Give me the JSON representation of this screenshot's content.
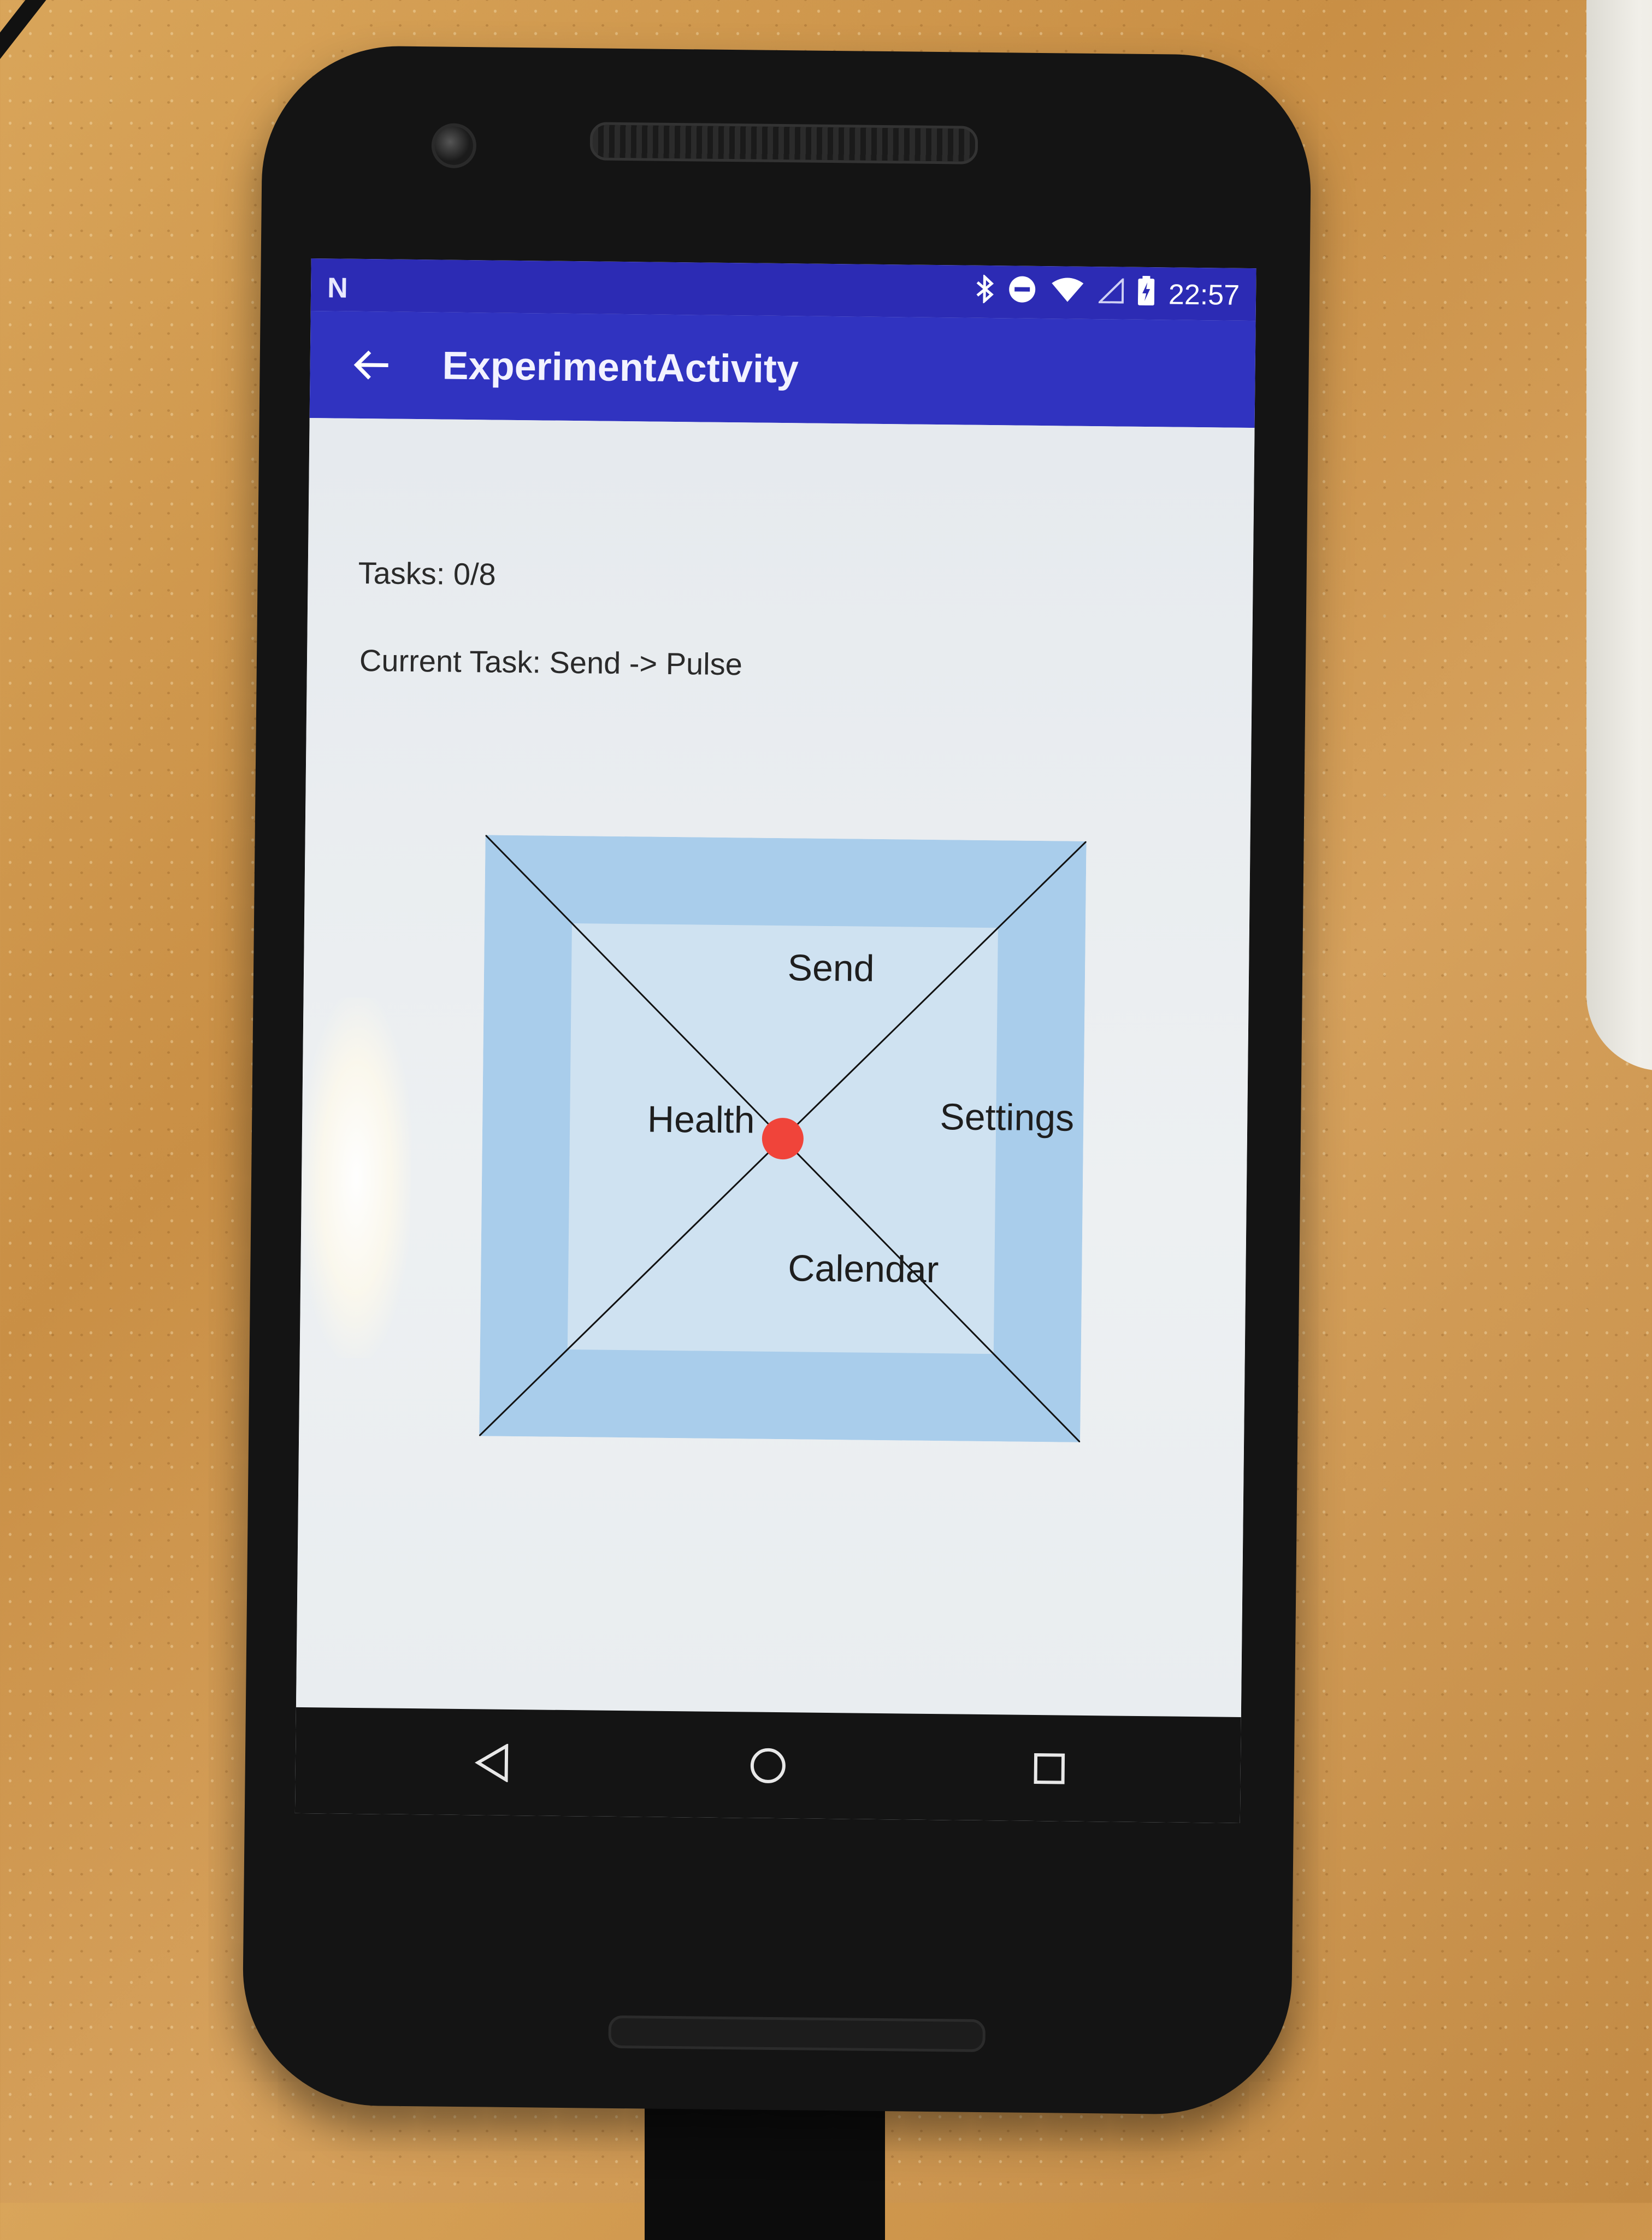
{
  "device": {
    "status_bar": {
      "time": "22:57",
      "left_icon": "n-notification-icon",
      "icons": [
        "bluetooth-icon",
        "do-not-disturb-icon",
        "wifi-icon",
        "cell-signal-icon",
        "battery-charging-icon"
      ]
    },
    "navigation": [
      "back-triangle-icon",
      "home-circle-icon",
      "recents-square-icon"
    ]
  },
  "app_bar": {
    "back_icon": "arrow-left-icon",
    "title": "ExperimentActivity",
    "color": "#3033c0"
  },
  "main": {
    "tasks_label": "Tasks: 0/8",
    "current_task_label": "Current Task: Send -> Pulse"
  },
  "radial_menu": {
    "items": {
      "top": "Send",
      "left": "Health",
      "right": "Settings",
      "bottom": "Calendar"
    },
    "outer_color": "#a9cdeb",
    "inner_color": "#cfe2f1",
    "cursor_color": "#f0443a"
  }
}
